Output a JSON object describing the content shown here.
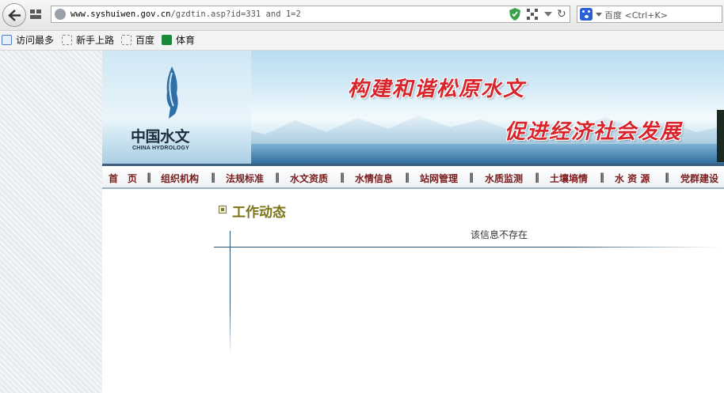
{
  "browser": {
    "url_host": "www.syshuiwen.gov.cn",
    "url_path": "/gzdtin.asp?id=331 and 1=2",
    "search_placeholder": "百度 <Ctrl+K>"
  },
  "bookmarks": [
    {
      "label": "访问最多",
      "icon": "magnifier-icon"
    },
    {
      "label": "新手上路",
      "icon": "blank-page-icon"
    },
    {
      "label": "百度",
      "icon": "blank-page-icon"
    },
    {
      "label": "体育",
      "icon": "sports-icon"
    }
  ],
  "banner": {
    "logo_cn": "中国水文",
    "logo_en": "CHINA HYDROLOGY",
    "slogan_1": "构建和谐松原水文",
    "slogan_2": "促进经济社会发展"
  },
  "nav": {
    "items": [
      "首　页",
      "组织机构",
      "法规标准",
      "水文资质",
      "水情信息",
      "站网管理",
      "水质监测",
      "土壤墒情",
      "水 资 源",
      "党群建设"
    ],
    "separator": "‖"
  },
  "content": {
    "section_title": "工作动态",
    "message": "该信息不存在"
  },
  "colors": {
    "nav_text": "#7a1c1c",
    "slogan": "#d8242b",
    "section_title": "#7b7416",
    "rule": "#2c5677"
  }
}
